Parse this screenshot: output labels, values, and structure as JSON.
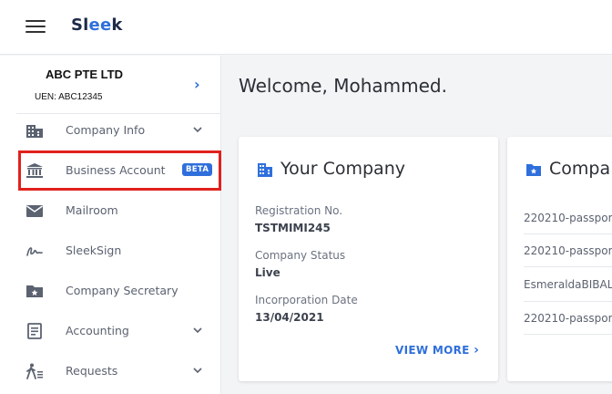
{
  "app": {
    "logo_prefix": "Sl",
    "logo_ee": "ee",
    "logo_suffix": "k"
  },
  "company": {
    "name": "ABC PTE LTD",
    "uen": "UEN: ABC12345"
  },
  "sidebar": {
    "items": [
      {
        "label": "Company Info",
        "icon": "building-icon",
        "chevron": true
      },
      {
        "label": "Business Account",
        "icon": "bank-icon",
        "badge": "BETA"
      },
      {
        "label": "Mailroom",
        "icon": "mail-icon"
      },
      {
        "label": "SleekSign",
        "icon": "signature-icon"
      },
      {
        "label": "Company Secretary",
        "icon": "folder-star-icon"
      },
      {
        "label": "Accounting",
        "icon": "ledger-icon",
        "chevron": true
      },
      {
        "label": "Requests",
        "icon": "walking-person-icon",
        "chevron": true
      }
    ]
  },
  "main": {
    "welcome": "Welcome, Mohammed.",
    "your_company": {
      "title": "Your Company",
      "fields": [
        {
          "label": "Registration No.",
          "value": "TSTMIMI245"
        },
        {
          "label": "Company Status",
          "value": "Live"
        },
        {
          "label": "Incorporation Date",
          "value": "13/04/2021"
        }
      ],
      "view_more": "VIEW MORE"
    },
    "documents": {
      "title": "Compa",
      "rows": [
        "220210-passpor",
        "220210-passpor",
        "EsmeraldaBIBAL_",
        "220210-passpor"
      ]
    }
  },
  "colors": {
    "accent": "#2f6fdc",
    "highlight": "#e0211d",
    "beta_bg": "#2f6fdc"
  }
}
